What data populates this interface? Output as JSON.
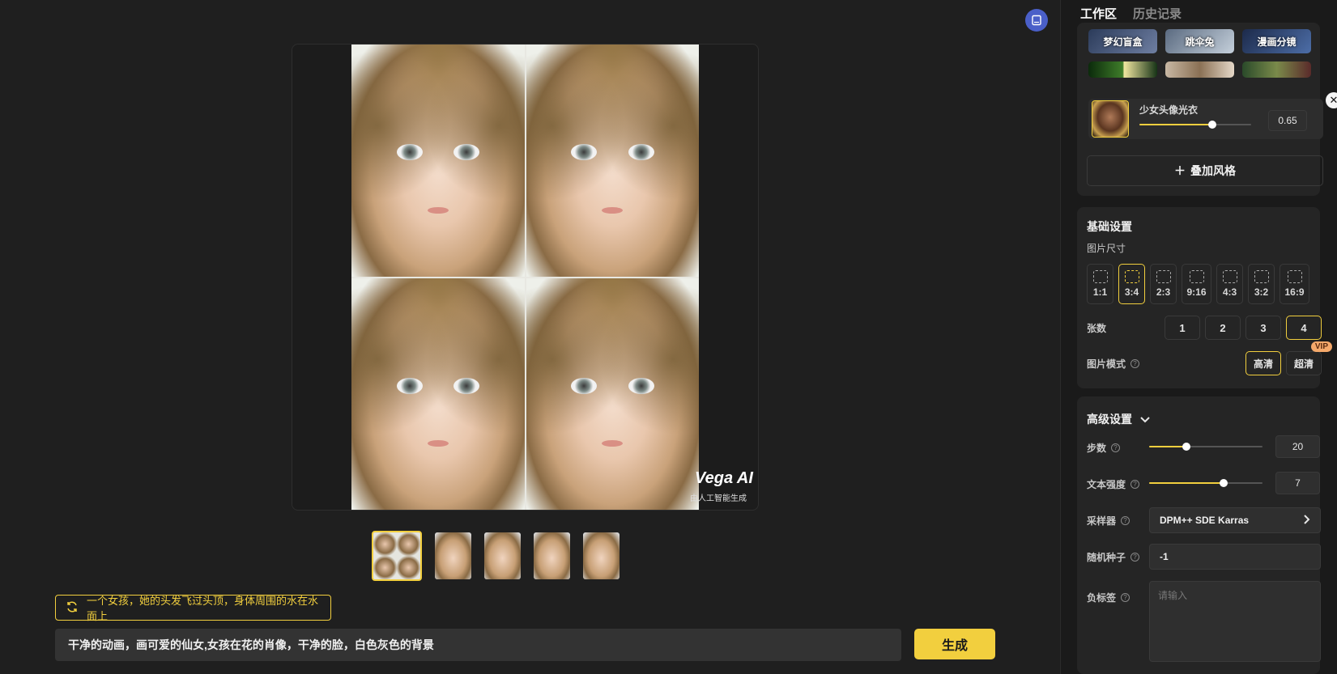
{
  "workspace": {
    "prompt_tag": "一个女孩，她的头发飞过头顶，身体周围的水在水面上",
    "prompt_text": "干净的动画，画可爱的仙女,女孩在花的肖像，干净的脸，白色灰色的背景",
    "generate_label": "生成",
    "watermark_title": "Vega AI",
    "watermark_sub": "由人工智能生成",
    "thumbnail_count": 5,
    "selected_thumbnail": 0
  },
  "panel": {
    "tabs": [
      {
        "label": "工作区",
        "active": true
      },
      {
        "label": "历史记录",
        "active": false
      }
    ],
    "style_tiles": [
      {
        "label": "梦幻盲盒"
      },
      {
        "label": "跳伞兔"
      },
      {
        "label": "漫画分镜"
      },
      {
        "label": ""
      },
      {
        "label": ""
      },
      {
        "label": ""
      }
    ],
    "lora": {
      "name": "少女头像光衣",
      "value": "0.65",
      "fraction": 0.65
    },
    "add_style_label": "叠加风格",
    "basic": {
      "title": "基础设置",
      "size_label": "图片尺寸",
      "ratios": [
        "1:1",
        "3:4",
        "2:3",
        "9:16",
        "4:3",
        "3:2",
        "16:9"
      ],
      "selected_ratio": "3:4",
      "count_label": "张数",
      "counts": [
        "1",
        "2",
        "3",
        "4"
      ],
      "selected_count": "4",
      "mode_label": "图片模式",
      "modes": [
        "高清",
        "超清"
      ],
      "selected_mode": "高清",
      "vip_badge": "VIP"
    },
    "advanced": {
      "title": "高级设置",
      "steps_label": "步数",
      "steps_value": "20",
      "steps_fraction": 0.33,
      "strength_label": "文本强度",
      "strength_value": "7",
      "strength_fraction": 0.66,
      "sampler_label": "采样器",
      "sampler_value": "DPM++ SDE Karras",
      "seed_label": "随机种子",
      "seed_value": "-1",
      "negative_label": "负标签",
      "negative_placeholder": "请输入"
    }
  },
  "colors": {
    "accent": "#f2cf3e",
    "background": "#1f1f1f",
    "panel": "#252525"
  }
}
